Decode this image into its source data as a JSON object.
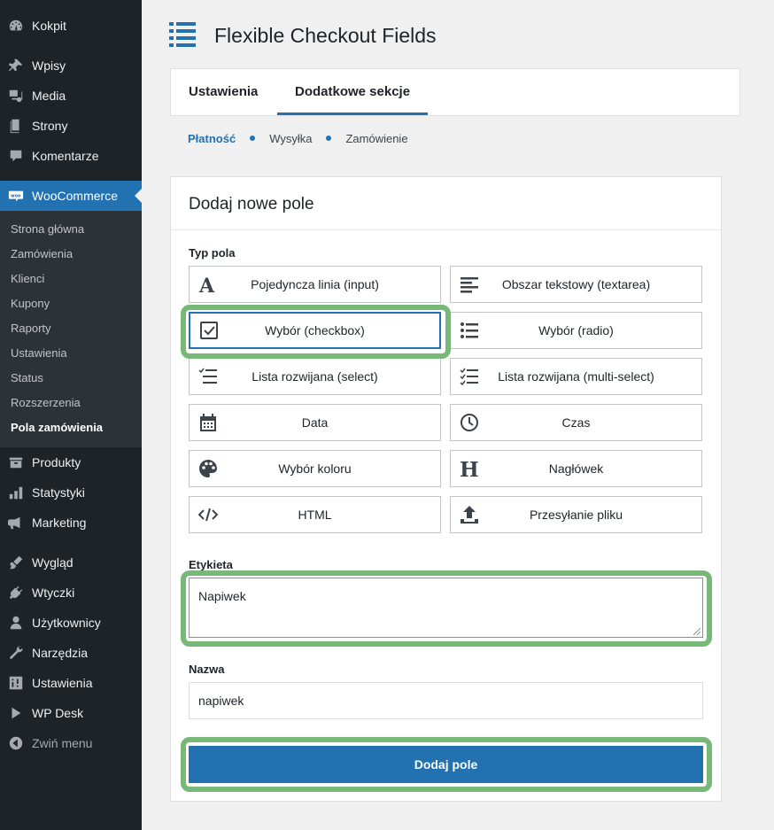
{
  "sidebar": {
    "items": [
      {
        "label": "Kokpit",
        "icon": "dashboard-icon"
      },
      {
        "label": "Wpisy",
        "icon": "pin-icon"
      },
      {
        "label": "Media",
        "icon": "media-icon"
      },
      {
        "label": "Strony",
        "icon": "pages-icon"
      },
      {
        "label": "Komentarze",
        "icon": "comments-icon"
      },
      {
        "label": "WooCommerce",
        "icon": "woo-icon",
        "active": true
      },
      {
        "label": "Produkty",
        "icon": "products-icon"
      },
      {
        "label": "Statystyki",
        "icon": "stats-icon"
      },
      {
        "label": "Marketing",
        "icon": "megaphone-icon"
      },
      {
        "label": "Wygląd",
        "icon": "brush-icon"
      },
      {
        "label": "Wtyczki",
        "icon": "plugin-icon"
      },
      {
        "label": "Użytkownicy",
        "icon": "user-icon"
      },
      {
        "label": "Narzędzia",
        "icon": "wrench-icon"
      },
      {
        "label": "Ustawienia",
        "icon": "settings-icon"
      },
      {
        "label": "WP Desk",
        "icon": "play-icon"
      },
      {
        "label": "Zwiń menu",
        "icon": "collapse-icon"
      }
    ],
    "submenu": [
      {
        "label": "Strona główna"
      },
      {
        "label": "Zamówienia"
      },
      {
        "label": "Klienci"
      },
      {
        "label": "Kupony"
      },
      {
        "label": "Raporty"
      },
      {
        "label": "Ustawienia"
      },
      {
        "label": "Status"
      },
      {
        "label": "Rozszerzenia"
      },
      {
        "label": "Pola zamówienia",
        "current": true
      }
    ]
  },
  "header": {
    "title": "Flexible Checkout Fields",
    "icon": "list-icon"
  },
  "tabs": [
    {
      "label": "Ustawienia"
    },
    {
      "label": "Dodatkowe sekcje",
      "active": true
    }
  ],
  "subtabs": [
    {
      "label": "Płatność",
      "active": true
    },
    {
      "label": "Wysyłka"
    },
    {
      "label": "Zamówienie"
    }
  ],
  "panel": {
    "title": "Dodaj nowe pole",
    "type_label": "Typ pola",
    "field_types": [
      {
        "label": "Pojedyncza linia (input)",
        "icon": "text-a-icon"
      },
      {
        "label": "Obszar tekstowy (textarea)",
        "icon": "align-left-icon"
      },
      {
        "label": "Wybór (checkbox)",
        "icon": "checkbox-icon",
        "selected": true
      },
      {
        "label": "Wybór (radio)",
        "icon": "list-bullets-icon"
      },
      {
        "label": "Lista rozwijana (select)",
        "icon": "select-list-icon"
      },
      {
        "label": "Lista rozwijana (multi-select)",
        "icon": "multiselect-icon"
      },
      {
        "label": "Data",
        "icon": "calendar-icon"
      },
      {
        "label": "Czas",
        "icon": "clock-icon"
      },
      {
        "label": "Wybór koloru",
        "icon": "palette-icon"
      },
      {
        "label": "Nagłówek",
        "icon": "heading-icon"
      },
      {
        "label": "HTML",
        "icon": "code-icon"
      },
      {
        "label": "Przesyłanie pliku",
        "icon": "upload-icon"
      }
    ],
    "label_label": "Etykieta",
    "label_value": "Napiwek",
    "name_label": "Nazwa",
    "name_value": "napiwek",
    "submit_label": "Dodaj pole"
  },
  "colors": {
    "accent": "#2271b1",
    "highlight": "#78b878",
    "sidebar_bg": "#1d2327"
  }
}
